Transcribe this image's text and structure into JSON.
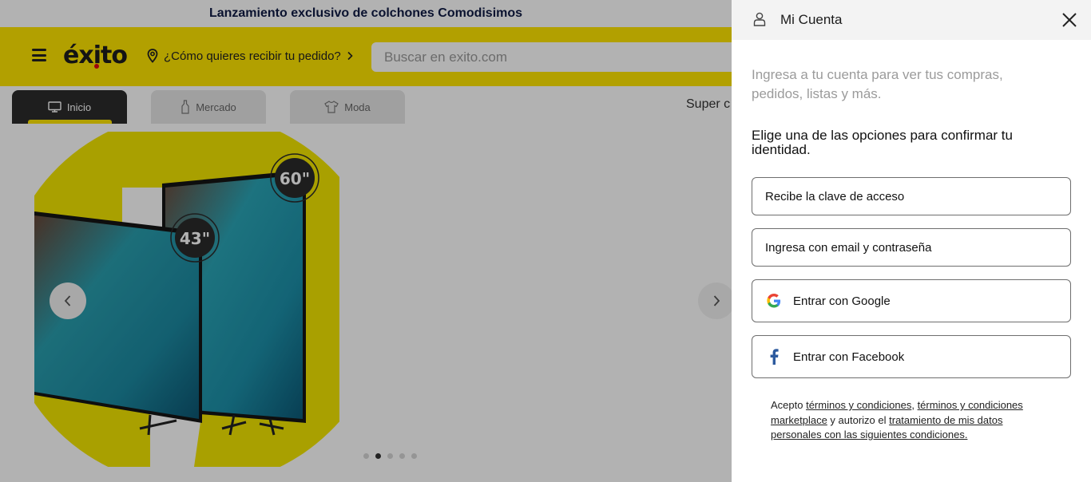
{
  "promo": {
    "text": "Lanzamiento exclusivo de colchones Comodisimos"
  },
  "header": {
    "logo": "éxito",
    "delivery_label": "¿Cómo quieres recibir tu pedido?",
    "search_placeholder": "Buscar en exito.com"
  },
  "categories": {
    "tabs": [
      {
        "label": "Inicio",
        "icon": "tv-icon",
        "active": true
      },
      {
        "label": "Mercado",
        "icon": "bottle-icon",
        "active": false
      },
      {
        "label": "Moda",
        "icon": "shirt-icon",
        "active": false
      }
    ],
    "extra_text": "Super c"
  },
  "hero": {
    "badges": [
      "60\"",
      "43\""
    ],
    "dots_total": 5,
    "dots_active": 2
  },
  "panel": {
    "title": "Mi Cuenta",
    "intro": "Ingresa a tu cuenta para ver tus compras, pedidos, listas y más.",
    "subtitle": "Elige una de las opciones para confirmar tu identidad.",
    "options": [
      {
        "label": "Recibe la clave de acceso"
      },
      {
        "label": "Ingresa con email y contraseña"
      },
      {
        "label": "Entrar con Google",
        "icon": "google-icon"
      },
      {
        "label": "Entrar con Facebook",
        "icon": "facebook-icon"
      }
    ],
    "legal": {
      "prefix": "Acepto ",
      "link1": "términos y condiciones",
      "sep": ", ",
      "link2": "términos y condiciones marketplace",
      "middle": " y autorizo el ",
      "link3": "tratamiento de mis datos personales con las siguientes condiciones."
    }
  },
  "colors": {
    "brand_yellow": "#ffe600",
    "overlay": "rgba(0,0,0,0.30)",
    "google_blue": "#4285F4",
    "facebook_blue": "#1877F2"
  }
}
